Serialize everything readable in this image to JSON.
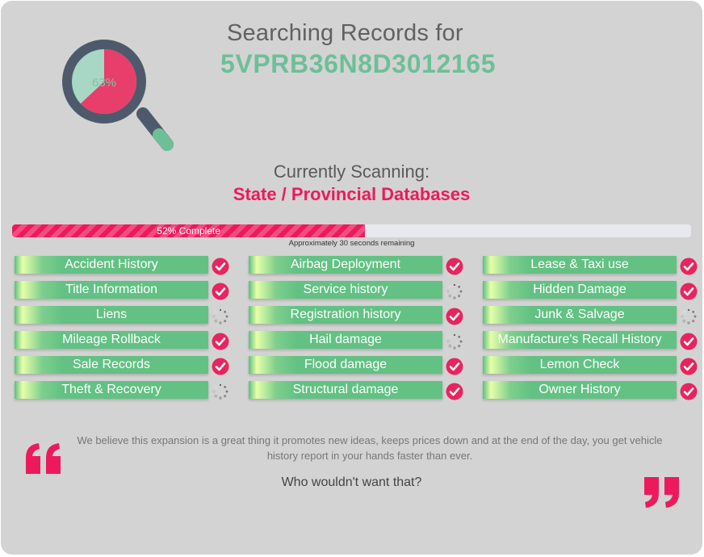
{
  "header": {
    "title": "Searching Records for",
    "vin": "5VPRB36N8D3012165"
  },
  "gauge": {
    "percent_label": "63%",
    "value": 0.63,
    "filled_color": "#e83e6c",
    "remaining_color": "#a8d7c5"
  },
  "scanning": {
    "label": "Currently Scanning:",
    "target": "State / Provincial Databases"
  },
  "progress": {
    "value": 0.52,
    "label": "52% Complete",
    "remaining_text": "Approximately 30 seconds remaining"
  },
  "colors": {
    "accent_pink": "#ec1a5c",
    "accent_green": "#6dbf98",
    "item_green": "#62c183"
  },
  "checks": [
    {
      "label": "Accident History",
      "status": "done"
    },
    {
      "label": "Title Information",
      "status": "done"
    },
    {
      "label": "Liens",
      "status": "loading"
    },
    {
      "label": "Mileage Rollback",
      "status": "done"
    },
    {
      "label": "Sale Records",
      "status": "done"
    },
    {
      "label": "Theft & Recovery",
      "status": "loading"
    },
    {
      "label": "Airbag Deployment",
      "status": "done"
    },
    {
      "label": "Service history",
      "status": "loading"
    },
    {
      "label": "Registration history",
      "status": "done"
    },
    {
      "label": "Hail damage",
      "status": "loading"
    },
    {
      "label": "Flood damage",
      "status": "done"
    },
    {
      "label": "Structural damage",
      "status": "done"
    },
    {
      "label": "Lease & Taxi use",
      "status": "done"
    },
    {
      "label": "Hidden Damage",
      "status": "done"
    },
    {
      "label": "Junk & Salvage",
      "status": "loading"
    },
    {
      "label": "Manufacture's Recall History",
      "status": "done"
    },
    {
      "label": "Lemon Check",
      "status": "done"
    },
    {
      "label": "Owner History",
      "status": "done"
    }
  ],
  "icons": {
    "done": "check-circle-icon",
    "loading": "spinner-icon",
    "search": "magnifier-icon",
    "quote_open": "open-quote-icon",
    "quote_close": "close-quote-icon"
  },
  "quote": {
    "text": "We believe this expansion is a great thing it promotes new ideas, keeps prices down and at the end of the day, you get vehicle history report in your hands faster than ever.",
    "question": "Who wouldn't want that?"
  }
}
